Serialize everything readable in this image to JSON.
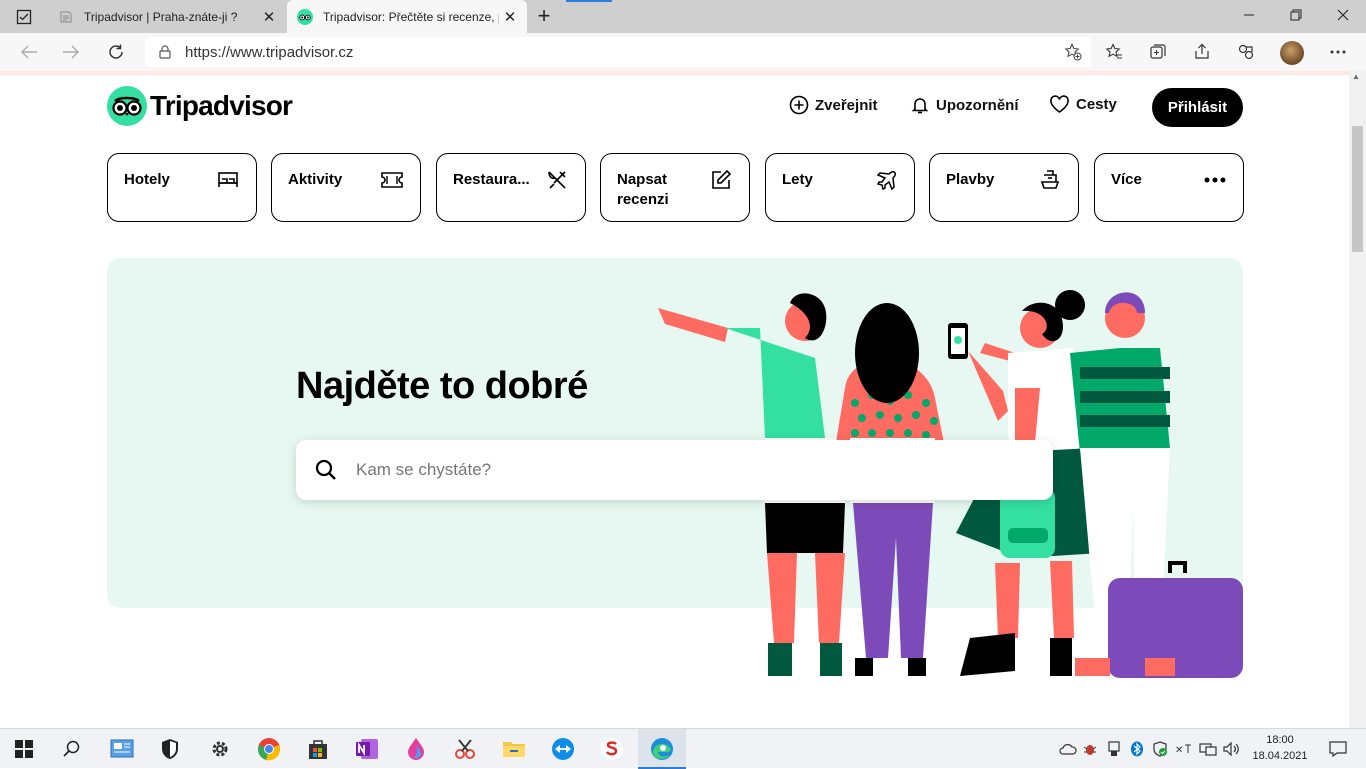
{
  "browser": {
    "tabs": [
      {
        "title": "Tripadvisor | Praha-znáte-ji ?",
        "active": false
      },
      {
        "title": "Tripadvisor: Přečtěte si recenze, p",
        "active": true
      }
    ],
    "url": "https://www.tripadvisor.cz",
    "close_glyph": "✕",
    "new_tab_glyph": "+"
  },
  "site": {
    "logo_text": "Tripadvisor",
    "header": {
      "post": "Zveřejnit",
      "alerts": "Upozornění",
      "trips": "Cesty",
      "signin": "Přihlásit"
    },
    "categories": [
      {
        "label": "Hotely",
        "icon": "bed-icon"
      },
      {
        "label": "Aktivity",
        "icon": "ticket-icon"
      },
      {
        "label": "Restaura...",
        "icon": "cutlery-icon"
      },
      {
        "label": "Napsat recenzi",
        "icon": "edit-icon"
      },
      {
        "label": "Lety",
        "icon": "plane-icon"
      },
      {
        "label": "Plavby",
        "icon": "ship-icon"
      },
      {
        "label": "Více",
        "icon": "more-icon"
      }
    ],
    "hero": {
      "title": "Najděte to dobré",
      "search_placeholder": "Kam se chystáte?"
    },
    "colors": {
      "brand_green": "#34e0a1",
      "hero_bg": "#e6f8f1"
    }
  },
  "taskbar": {
    "time": "18:00",
    "date": "18.04.2021"
  }
}
